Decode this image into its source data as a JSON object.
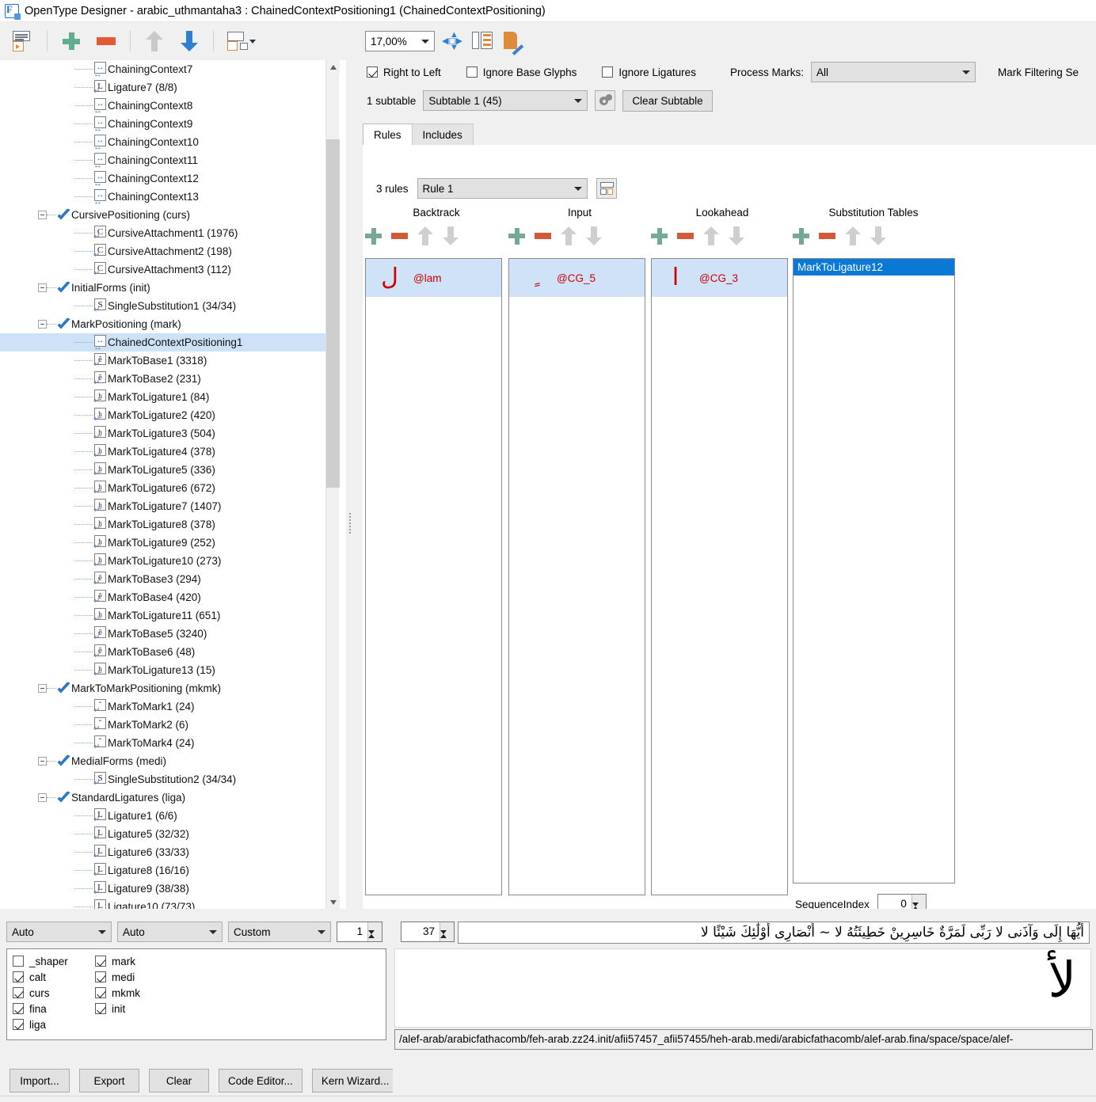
{
  "window": {
    "title": "OpenType Designer - arabic_uthmantaha3 : ChainedContextPositioning1 (ChainedContextPositioning)",
    "icon": "app-icon"
  },
  "left_toolbar": {
    "buttons": [
      {
        "name": "new-lookup-button",
        "icon": "list-play-icon"
      },
      {
        "name": "add-button",
        "icon": "plus-icon"
      },
      {
        "name": "remove-button",
        "icon": "minus-icon"
      },
      {
        "name": "move-up-button",
        "icon": "arrow-up-icon"
      },
      {
        "name": "move-down-button",
        "icon": "arrow-down-icon"
      },
      {
        "name": "lookup-options-button",
        "icon": "list-dropdown-icon"
      }
    ]
  },
  "tree": {
    "items": [
      {
        "label": "ChainingContext7",
        "icon": "chaining-icon",
        "depth": 2,
        "twisty": false,
        "selected": false
      },
      {
        "label": "Ligature7 (8/8)",
        "icon": "ligature-icon",
        "depth": 2,
        "twisty": false,
        "selected": false
      },
      {
        "label": "ChainingContext8",
        "icon": "chaining-icon",
        "depth": 2,
        "twisty": false,
        "selected": false
      },
      {
        "label": "ChainingContext9",
        "icon": "chaining-icon",
        "depth": 2,
        "twisty": false,
        "selected": false
      },
      {
        "label": "ChainingContext10",
        "icon": "chaining-icon",
        "depth": 2,
        "twisty": false,
        "selected": false
      },
      {
        "label": "ChainingContext11",
        "icon": "chaining-icon",
        "depth": 2,
        "twisty": false,
        "selected": false
      },
      {
        "label": "ChainingContext12",
        "icon": "chaining-icon",
        "depth": 2,
        "twisty": false,
        "selected": false
      },
      {
        "label": "ChainingContext13",
        "icon": "chaining-icon",
        "depth": 2,
        "twisty": false,
        "selected": false
      },
      {
        "label": "CursivePositioning (curs)",
        "icon": "feature-icon",
        "depth": 1,
        "twisty": true,
        "selected": false
      },
      {
        "label": "CursiveAttachment1 (1976)",
        "icon": "cursive-icon",
        "depth": 2,
        "twisty": false,
        "selected": false
      },
      {
        "label": "CursiveAttachment2 (198)",
        "icon": "cursive-icon",
        "depth": 2,
        "twisty": false,
        "selected": false
      },
      {
        "label": "CursiveAttachment3 (112)",
        "icon": "cursive-icon",
        "depth": 2,
        "twisty": false,
        "selected": false
      },
      {
        "label": "InitialForms (init)",
        "icon": "feature-icon",
        "depth": 1,
        "twisty": true,
        "selected": false
      },
      {
        "label": "SingleSubstitution1 (34/34)",
        "icon": "single-sub-icon",
        "depth": 2,
        "twisty": false,
        "selected": false
      },
      {
        "label": "MarkPositioning (mark)",
        "icon": "feature-icon",
        "depth": 1,
        "twisty": true,
        "selected": false
      },
      {
        "label": "ChainedContextPositioning1",
        "icon": "chaining-icon",
        "depth": 2,
        "twisty": false,
        "selected": true
      },
      {
        "label": "MarkToBase1 (3318)",
        "icon": "mark-base-icon",
        "depth": 2,
        "twisty": false,
        "selected": false
      },
      {
        "label": "MarkToBase2 (231)",
        "icon": "mark-base-icon",
        "depth": 2,
        "twisty": false,
        "selected": false
      },
      {
        "label": "MarkToLigature1 (84)",
        "icon": "mark-ligature-icon",
        "depth": 2,
        "twisty": false,
        "selected": false
      },
      {
        "label": "MarkToLigature2 (420)",
        "icon": "mark-ligature-icon",
        "depth": 2,
        "twisty": false,
        "selected": false
      },
      {
        "label": "MarkToLigature3 (504)",
        "icon": "mark-ligature-icon",
        "depth": 2,
        "twisty": false,
        "selected": false
      },
      {
        "label": "MarkToLigature4 (378)",
        "icon": "mark-ligature-icon",
        "depth": 2,
        "twisty": false,
        "selected": false
      },
      {
        "label": "MarkToLigature5 (336)",
        "icon": "mark-ligature-icon",
        "depth": 2,
        "twisty": false,
        "selected": false
      },
      {
        "label": "MarkToLigature6 (672)",
        "icon": "mark-ligature-icon",
        "depth": 2,
        "twisty": false,
        "selected": false
      },
      {
        "label": "MarkToLigature7 (1407)",
        "icon": "mark-ligature-icon",
        "depth": 2,
        "twisty": false,
        "selected": false
      },
      {
        "label": "MarkToLigature8 (378)",
        "icon": "mark-ligature-icon",
        "depth": 2,
        "twisty": false,
        "selected": false
      },
      {
        "label": "MarkToLigature9 (252)",
        "icon": "mark-ligature-icon",
        "depth": 2,
        "twisty": false,
        "selected": false
      },
      {
        "label": "MarkToLigature10 (273)",
        "icon": "mark-ligature-icon",
        "depth": 2,
        "twisty": false,
        "selected": false
      },
      {
        "label": "MarkToBase3 (294)",
        "icon": "mark-base-icon",
        "depth": 2,
        "twisty": false,
        "selected": false
      },
      {
        "label": "MarkToBase4 (420)",
        "icon": "mark-base-icon",
        "depth": 2,
        "twisty": false,
        "selected": false
      },
      {
        "label": "MarkToLigature11 (651)",
        "icon": "mark-ligature-icon",
        "depth": 2,
        "twisty": false,
        "selected": false
      },
      {
        "label": "MarkToBase5 (3240)",
        "icon": "mark-base-icon",
        "depth": 2,
        "twisty": false,
        "selected": false
      },
      {
        "label": "MarkToBase6 (48)",
        "icon": "mark-base-icon",
        "depth": 2,
        "twisty": false,
        "selected": false
      },
      {
        "label": "MarkToLigature13 (15)",
        "icon": "mark-ligature-icon",
        "depth": 2,
        "twisty": false,
        "selected": false
      },
      {
        "label": "MarkToMarkPositioning (mkmk)",
        "icon": "feature-icon",
        "depth": 1,
        "twisty": true,
        "selected": false
      },
      {
        "label": "MarkToMark1 (24)",
        "icon": "mark-mark-icon",
        "depth": 2,
        "twisty": false,
        "selected": false
      },
      {
        "label": "MarkToMark2 (6)",
        "icon": "mark-mark-icon",
        "depth": 2,
        "twisty": false,
        "selected": false
      },
      {
        "label": "MarkToMark4 (24)",
        "icon": "mark-mark-icon",
        "depth": 2,
        "twisty": false,
        "selected": false
      },
      {
        "label": "MedialForms (medi)",
        "icon": "feature-icon",
        "depth": 1,
        "twisty": true,
        "selected": false
      },
      {
        "label": "SingleSubstitution2 (34/34)",
        "icon": "single-sub-icon",
        "depth": 2,
        "twisty": false,
        "selected": false
      },
      {
        "label": "StandardLigatures (liga)",
        "icon": "feature-icon",
        "depth": 1,
        "twisty": true,
        "selected": false
      },
      {
        "label": "Ligature1 (6/6)",
        "icon": "ligature-icon",
        "depth": 2,
        "twisty": false,
        "selected": false
      },
      {
        "label": "Ligature5 (32/32)",
        "icon": "ligature-icon",
        "depth": 2,
        "twisty": false,
        "selected": false
      },
      {
        "label": "Ligature6 (33/33)",
        "icon": "ligature-icon",
        "depth": 2,
        "twisty": false,
        "selected": false
      },
      {
        "label": "Ligature8 (16/16)",
        "icon": "ligature-icon",
        "depth": 2,
        "twisty": false,
        "selected": false
      },
      {
        "label": "Ligature9 (38/38)",
        "icon": "ligature-icon",
        "depth": 2,
        "twisty": false,
        "selected": false
      },
      {
        "label": "Ligature10 (73/73)",
        "icon": "ligature-icon",
        "depth": 2,
        "twisty": false,
        "selected": false
      }
    ]
  },
  "right_toolbar": {
    "zoom_value": "17,00%",
    "buttons": [
      {
        "name": "fit-view-button",
        "icon": "fit-icon"
      },
      {
        "name": "table-view-button",
        "icon": "grid-icon"
      },
      {
        "name": "edit-glyph-button",
        "icon": "page-pencil-icon"
      }
    ]
  },
  "options": {
    "right_to_left": {
      "label": "Right to Left",
      "checked": true
    },
    "ignore_base_glyphs": {
      "label": "Ignore Base Glyphs",
      "checked": false
    },
    "ignore_ligatures": {
      "label": "Ignore Ligatures",
      "checked": false
    },
    "process_marks_label": "Process Marks:",
    "process_marks_value": "All",
    "mark_filtering_label": "Mark Filtering Se"
  },
  "subtable": {
    "count_label": "1 subtable",
    "selected": "Subtable 1 (45)",
    "clear_label": "Clear Subtable"
  },
  "tabs": [
    {
      "label": "Rules",
      "active": true
    },
    {
      "label": "Includes",
      "active": false
    }
  ],
  "rules": {
    "count_label": "3 rules",
    "selected": "Rule 1",
    "columns": [
      {
        "header": "Backtrack",
        "name": "backtrack",
        "entries": [
          {
            "glyph": "ل",
            "class_name": "@lam"
          }
        ]
      },
      {
        "header": "Input",
        "name": "input",
        "entries": [
          {
            "glyph": "ٍ",
            "class_name": "@CG_5"
          }
        ]
      },
      {
        "header": "Lookahead",
        "name": "lookahead",
        "entries": [
          {
            "glyph": "ا",
            "class_name": "@CG_3"
          }
        ]
      },
      {
        "header": "Substitution Tables",
        "name": "substitution-tables",
        "entries": [
          {
            "label": "MarkToLigature12",
            "selected": true
          }
        ]
      }
    ],
    "sequence_index_label": "SequenceIndex",
    "sequence_index_value": "0"
  },
  "bottom_left": {
    "script_select": "Auto",
    "language_select": "Auto",
    "feature_mode_select": "Custom",
    "repeat_value": "1",
    "features": [
      {
        "label": "_shaper",
        "checked": false
      },
      {
        "label": "mark",
        "checked": true
      },
      {
        "label": "calt",
        "checked": true
      },
      {
        "label": "medi",
        "checked": true
      },
      {
        "label": "curs",
        "checked": true
      },
      {
        "label": "mkmk",
        "checked": true
      },
      {
        "label": "fina",
        "checked": true
      },
      {
        "label": "init",
        "checked": true
      },
      {
        "label": "liga",
        "checked": true
      }
    ],
    "buttons": [
      {
        "label": "Import...",
        "name": "import-button"
      },
      {
        "label": "Export",
        "name": "export-button"
      },
      {
        "label": "Clear",
        "name": "clear-button"
      },
      {
        "label": "Code Editor...",
        "name": "code-editor-button"
      },
      {
        "label": "Kern Wizard...",
        "name": "kern-wizard-button"
      }
    ]
  },
  "bottom_right": {
    "size_value": "37",
    "sample_text": "أَيُّهَا إِلَى وَآذَنى لا رَبِّى لَمَرَّةٌ خَاسِرِينْ خَطِيئَتُهُ لا ~ أَنْصَارِى أُوْلَٰئِكَ شَيْئًا لا",
    "preview_glyph": "لأ",
    "glyph_path": "/alef-arab/arabicfathacomb/feh-arab.zz24.init/afii57457_afii57455/heh-arab.medi/arabicfathacomb/alef-arab.fina/space/space/alef-"
  }
}
